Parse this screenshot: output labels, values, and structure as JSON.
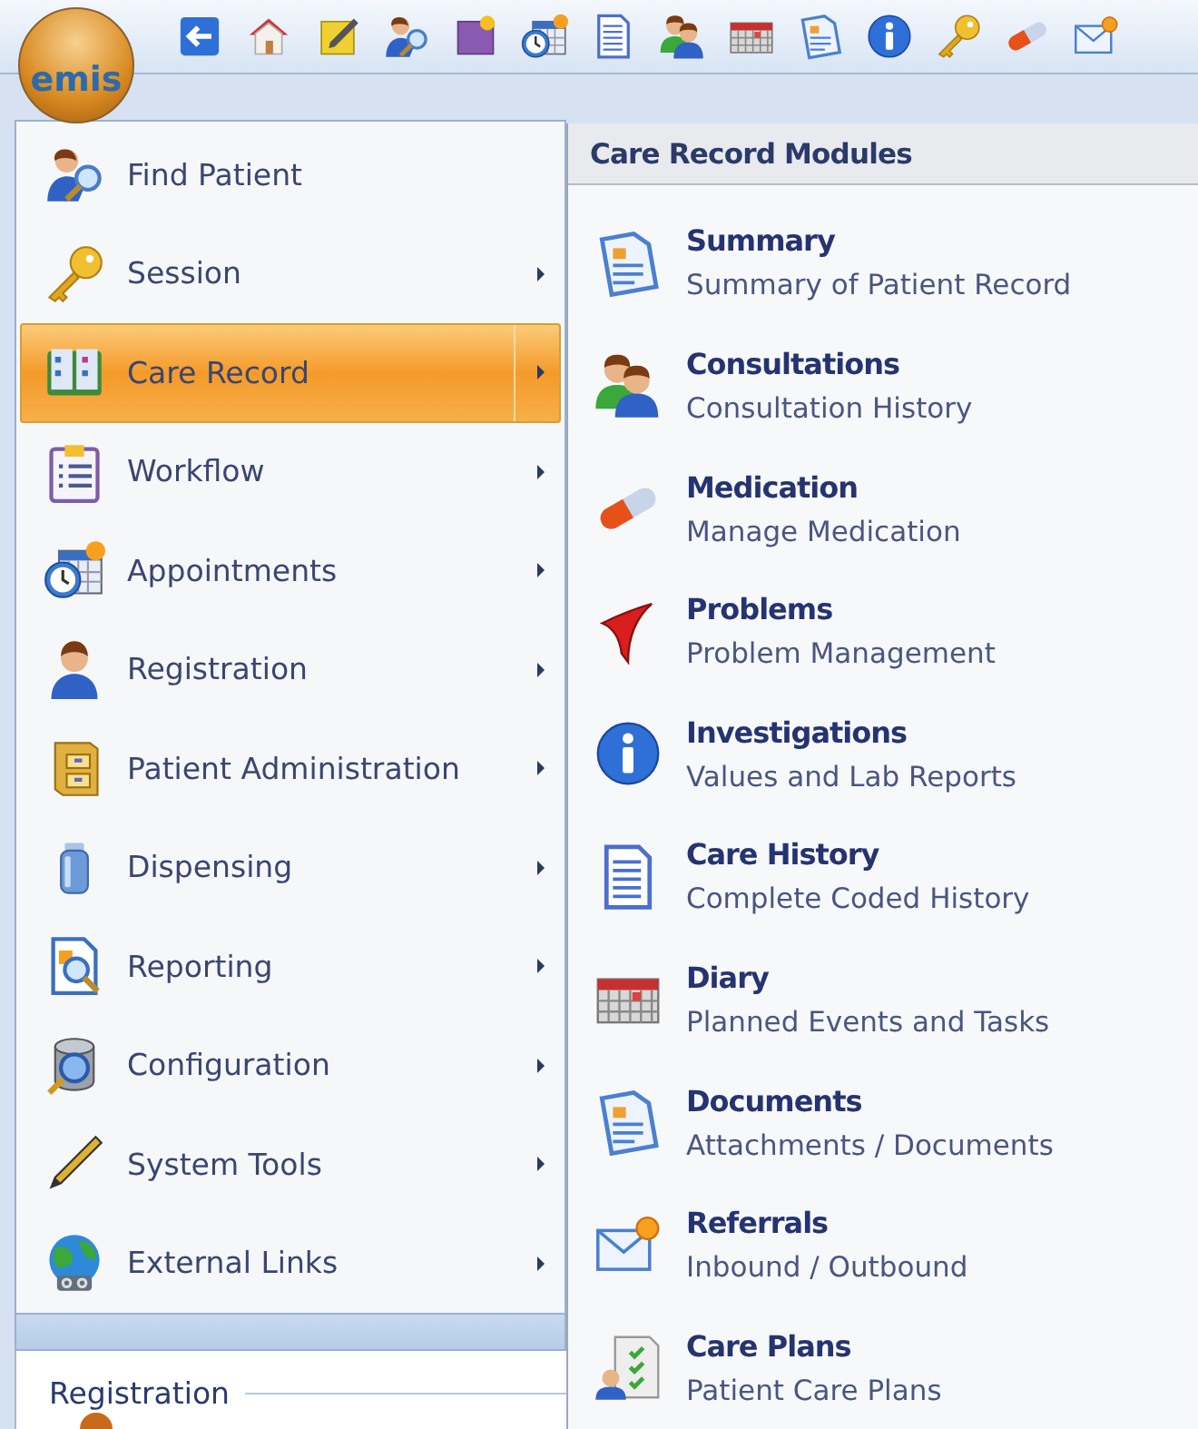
{
  "logo": {
    "text": "emis"
  },
  "menu": {
    "items": [
      {
        "label": "Find Patient",
        "has_submenu": false,
        "selected": false
      },
      {
        "label": "Session",
        "has_submenu": true,
        "selected": false
      },
      {
        "label": "Care Record",
        "has_submenu": true,
        "selected": true
      },
      {
        "label": "Workflow",
        "has_submenu": true,
        "selected": false
      },
      {
        "label": "Appointments",
        "has_submenu": true,
        "selected": false
      },
      {
        "label": "Registration",
        "has_submenu": true,
        "selected": false
      },
      {
        "label": "Patient Administration",
        "has_submenu": true,
        "selected": false
      },
      {
        "label": "Dispensing",
        "has_submenu": true,
        "selected": false
      },
      {
        "label": "Reporting",
        "has_submenu": true,
        "selected": false
      },
      {
        "label": "Configuration",
        "has_submenu": true,
        "selected": false
      },
      {
        "label": "System Tools",
        "has_submenu": true,
        "selected": false
      },
      {
        "label": "External Links",
        "has_submenu": true,
        "selected": false
      }
    ]
  },
  "submenu": {
    "title": "Care Record Modules",
    "items": [
      {
        "title": "Summary",
        "description": "Summary of Patient Record"
      },
      {
        "title": "Consultations",
        "description": "Consultation History"
      },
      {
        "title": "Medication",
        "description": "Manage Medication"
      },
      {
        "title": "Problems",
        "description": "Problem Management"
      },
      {
        "title": "Investigations",
        "description": "Values and Lab Reports"
      },
      {
        "title": "Care History",
        "description": "Complete Coded History"
      },
      {
        "title": "Diary",
        "description": "Planned Events and Tasks"
      },
      {
        "title": "Documents",
        "description": "Attachments / Documents"
      },
      {
        "title": "Referrals",
        "description": "Inbound / Outbound"
      },
      {
        "title": "Care Plans",
        "description": "Patient Care Plans"
      }
    ]
  },
  "group": {
    "title": "Registration"
  }
}
